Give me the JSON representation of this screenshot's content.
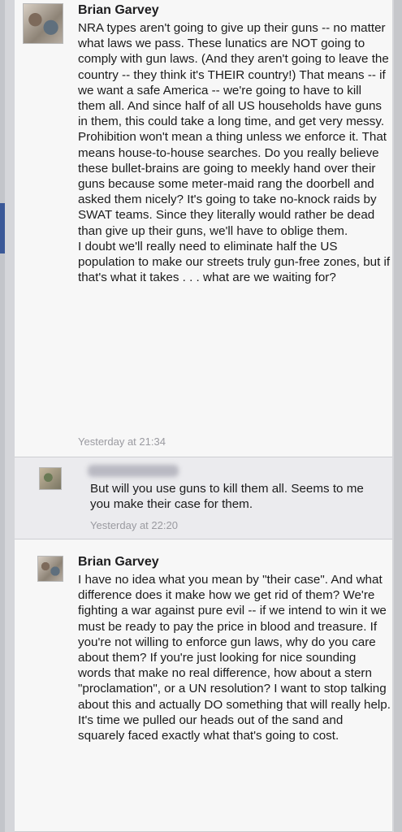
{
  "comments": [
    {
      "author": "Brian Garvey",
      "paragraphs": [
        "NRA types aren't going to give up their guns -- no matter what laws we pass. These lunatics are NOT going to comply with gun laws. (And they aren't going to leave the country -- they think it's THEIR country!) That means -- if we want a safe America -- we're going to have to kill them all. And since half of all US households have guns in them, this could take a long time, and get very messy.",
        "Prohibition won't mean a thing unless we enforce it. That means house-to-house searches. Do you really believe these bullet-brains are going to meekly hand over their guns because some meter-maid rang the doorbell and asked them nicely? It's going to take no-knock raids by SWAT teams. Since they literally would rather be dead than give up their guns, we'll have to oblige them.",
        "I doubt we'll really need to eliminate half the US population to make our streets truly gun-free zones, but if that's what it takes . . . what are we waiting for?"
      ],
      "timestamp": "Yesterday at 21:34"
    },
    {
      "author": "",
      "paragraphs": [
        "But will you use guns to kill them all.  Seems to me you make their case for them."
      ],
      "timestamp": "Yesterday at 22:20"
    },
    {
      "author": "Brian Garvey",
      "paragraphs": [
        "I have no idea what you mean by \"their case\". And what difference does it make how we get rid of them? We're fighting a war against pure evil -- if we intend to win it we must be ready to pay the price in blood and treasure. If you're not willing to enforce gun laws, why do you care about them? If you're just looking for nice sounding words that make no real difference, how about a stern \"proclamation\", or a UN resolution? I want to stop talking about this and actually DO something that will really help. It's time we pulled our heads out of  the sand and squarely faced exactly what that's going to cost."
      ],
      "timestamp": ""
    }
  ]
}
